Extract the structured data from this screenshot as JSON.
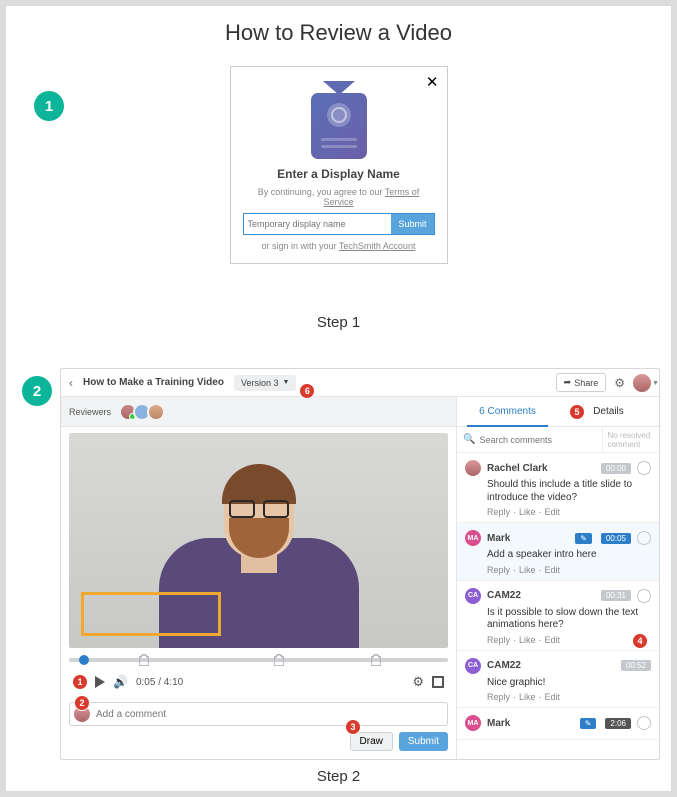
{
  "page_title": "How to Review a Video",
  "step_bubbles": {
    "one": "1",
    "two": "2"
  },
  "step_labels": {
    "one": "Step 1",
    "two": "Step 2"
  },
  "dialog": {
    "heading": "Enter a Display Name",
    "terms_prefix": "By continuing, you agree to our ",
    "terms_link": "Terms of Service",
    "placeholder": "Temporary display name",
    "submit": "Submit",
    "signin_prefix": "or sign in with your ",
    "signin_link": "TechSmith Account",
    "close": "✕"
  },
  "app": {
    "back": "‹",
    "title": "How to Make a Training Video",
    "version": "Version 3",
    "share": "Share",
    "reviewers_label": "Reviewers",
    "time_current": "0:05",
    "time_sep": " / ",
    "time_total": "4:10",
    "compose_placeholder": "Add a comment",
    "draw": "Draw",
    "submit": "Submit",
    "tabs": {
      "comments": "6 Comments",
      "details": "Details"
    },
    "search_placeholder": "Search comments",
    "resolved_hint": "No resolved comment",
    "comments": [
      {
        "av": "rc",
        "initials": "",
        "name": "Rachel Clark",
        "pencil": false,
        "ts": "00:00",
        "ts_style": "grey",
        "text": "Should this include a title slide to introduce the video?",
        "circle": true
      },
      {
        "av": "ma",
        "initials": "MA",
        "name": "Mark",
        "pencil": true,
        "ts": "00:05",
        "ts_style": "blue",
        "text": "Add a speaker intro here",
        "circle": true
      },
      {
        "av": "ca",
        "initials": "CA",
        "name": "CAM22",
        "pencil": false,
        "ts": "00:31",
        "ts_style": "grey",
        "text": "Is it possible to slow down the text animations here?",
        "circle": true
      },
      {
        "av": "ca",
        "initials": "CA",
        "name": "CAM22",
        "pencil": false,
        "ts": "00:52",
        "ts_style": "grey",
        "text": "Nice graphic!",
        "circle": false
      },
      {
        "av": "ma",
        "initials": "MA",
        "name": "Mark",
        "pencil": true,
        "ts": "2:06",
        "ts_style": "dark",
        "text": "",
        "circle": true
      }
    ],
    "actions": {
      "reply": "Reply",
      "like": "Like",
      "edit": "Edit"
    }
  },
  "callouts": {
    "c1": "1",
    "c2": "2",
    "c3": "3",
    "c4": "4",
    "c5": "5",
    "c6": "6"
  }
}
